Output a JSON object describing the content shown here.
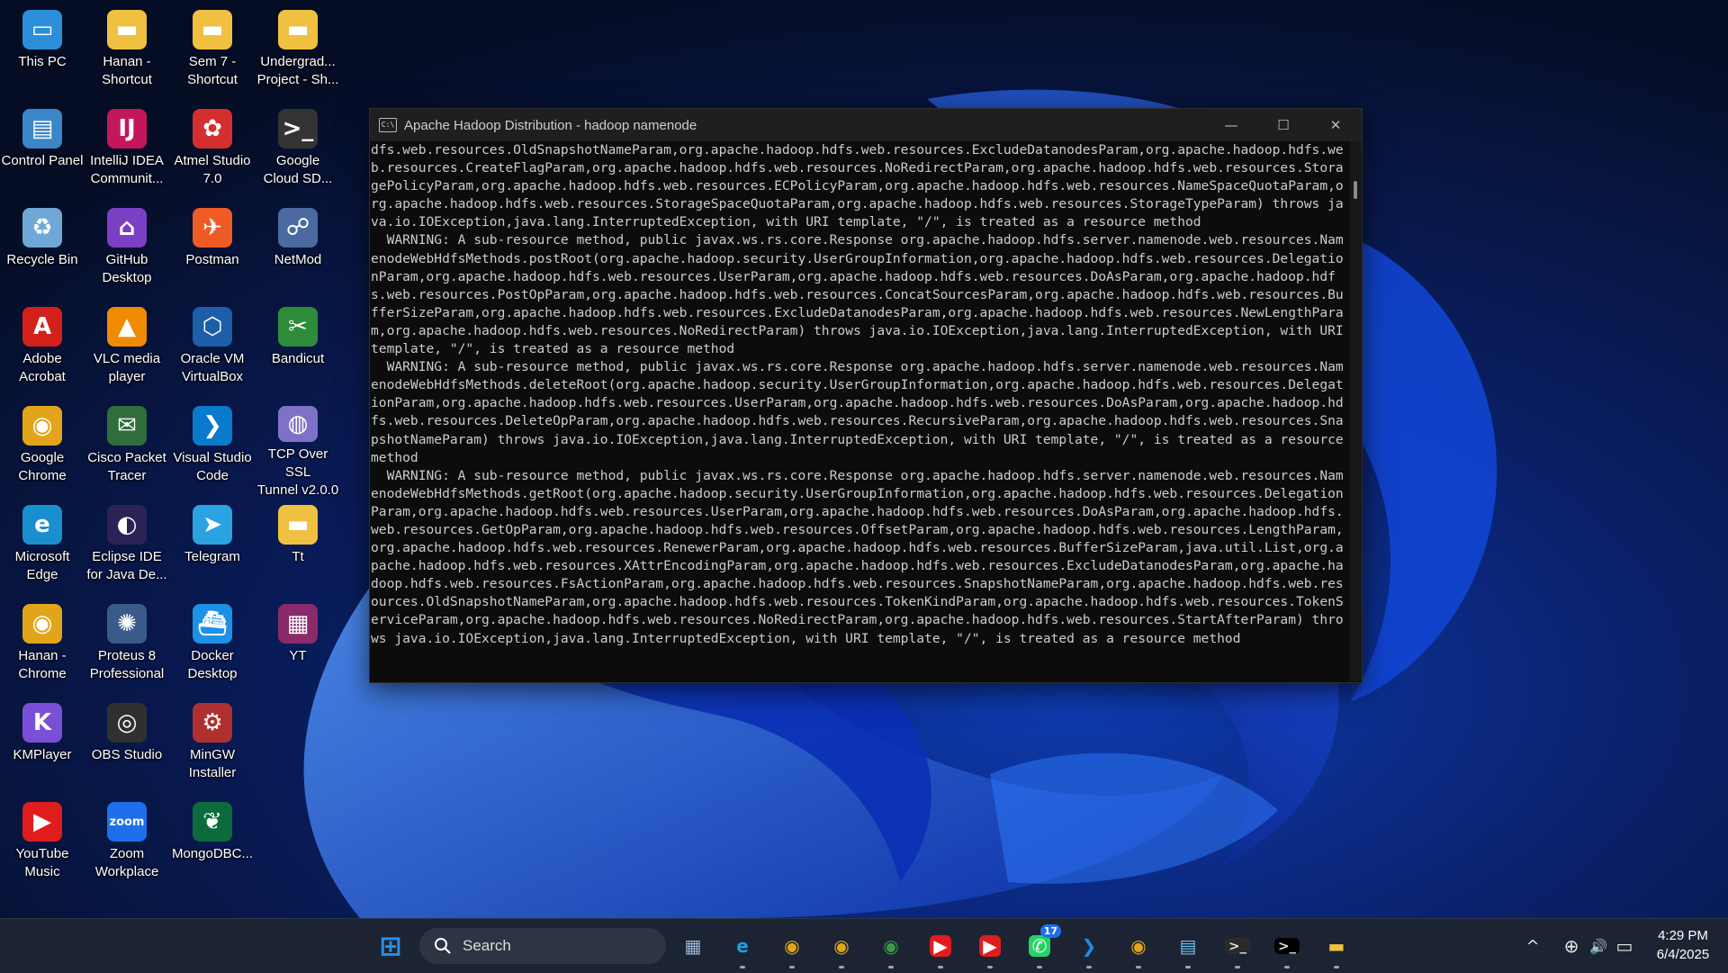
{
  "desktop_icons": [
    {
      "label": "This PC",
      "icon": "this-pc-icon",
      "color": "#2a8fd8",
      "glyph": "▭"
    },
    {
      "label": "Control Panel",
      "icon": "control-panel-icon",
      "color": "#3b86c8",
      "glyph": "▤"
    },
    {
      "label": "Recycle Bin",
      "icon": "recycle-bin-icon",
      "color": "#6fa8d6",
      "glyph": "♻"
    },
    {
      "label": "Adobe\nAcrobat",
      "icon": "adobe-acrobat-icon",
      "color": "#d4201a",
      "glyph": "A"
    },
    {
      "label": "Google\nChrome",
      "icon": "chrome-icon",
      "color": "#e2a51a",
      "glyph": "◉"
    },
    {
      "label": "Microsoft\nEdge",
      "icon": "edge-icon",
      "color": "#1a8fd0",
      "glyph": "e"
    },
    {
      "label": "Hanan -\nChrome",
      "icon": "chrome-profile-icon",
      "color": "#e2a51a",
      "glyph": "◉"
    },
    {
      "label": "KMPlayer",
      "icon": "kmplayer-icon",
      "color": "#7a4fd8",
      "glyph": "K"
    },
    {
      "label": "YouTube\nMusic",
      "icon": "youtube-music-icon",
      "color": "#e01c1c",
      "glyph": "▶"
    },
    {
      "label": "Hanan -\nShortcut",
      "icon": "folder-icon",
      "color": "#f0c040",
      "glyph": "▬"
    },
    {
      "label": "IntelliJ IDEA\nCommunit...",
      "icon": "intellij-icon",
      "color": "#c2185b",
      "glyph": "IJ"
    },
    {
      "label": "GitHub\nDesktop",
      "icon": "github-desktop-icon",
      "color": "#7b3fc4",
      "glyph": "⌂"
    },
    {
      "label": "VLC media\nplayer",
      "icon": "vlc-icon",
      "color": "#f08a00",
      "glyph": "▲"
    },
    {
      "label": "Cisco Packet\nTracer",
      "icon": "cisco-packet-tracer-icon",
      "color": "#2f6e3a",
      "glyph": "✉"
    },
    {
      "label": "Eclipse IDE\nfor Java De...",
      "icon": "eclipse-icon",
      "color": "#2c2255",
      "glyph": "◐"
    },
    {
      "label": "Proteus 8\nProfessional",
      "icon": "proteus-icon",
      "color": "#3a5a8a",
      "glyph": "✺"
    },
    {
      "label": "OBS Studio",
      "icon": "obs-studio-icon",
      "color": "#303030",
      "glyph": "◎"
    },
    {
      "label": "Zoom\nWorkplace",
      "icon": "zoom-icon",
      "color": "#1f6feb",
      "glyph": "zoom"
    },
    {
      "label": "Sem 7 -\nShortcut",
      "icon": "folder-icon",
      "color": "#f0c040",
      "glyph": "▬"
    },
    {
      "label": "Atmel Studio\n7.0",
      "icon": "atmel-studio-icon",
      "color": "#d32f2f",
      "glyph": "✿"
    },
    {
      "label": "Postman",
      "icon": "postman-icon",
      "color": "#ef5b25",
      "glyph": "✈"
    },
    {
      "label": "Oracle VM\nVirtualBox",
      "icon": "virtualbox-icon",
      "color": "#1c5ea8",
      "glyph": "⬡"
    },
    {
      "label": "Visual Studio\nCode",
      "icon": "vscode-icon",
      "color": "#0a7acc",
      "glyph": "❯"
    },
    {
      "label": "Telegram",
      "icon": "telegram-icon",
      "color": "#2aa3e0",
      "glyph": "➤"
    },
    {
      "label": "Docker\nDesktop",
      "icon": "docker-icon",
      "color": "#1d91e6",
      "glyph": "⛴"
    },
    {
      "label": "MinGW\nInstaller",
      "icon": "mingw-icon",
      "color": "#b03030",
      "glyph": "⚙"
    },
    {
      "label": "MongoDBC...",
      "icon": "mongodb-compass-icon",
      "color": "#0c6b3a",
      "glyph": "❦"
    },
    {
      "label": "Undergrad...\nProject - Sh...",
      "icon": "folder-icon",
      "color": "#f0c040",
      "glyph": "▬"
    },
    {
      "label": "Google\nCloud SD...",
      "icon": "google-cloud-sdk-icon",
      "color": "#333",
      "glyph": ">_"
    },
    {
      "label": "NetMod",
      "icon": "netmod-icon",
      "color": "#4a6aa0",
      "glyph": "☍"
    },
    {
      "label": "Bandicut",
      "icon": "bandicut-icon",
      "color": "#2e8b3a",
      "glyph": "✂"
    },
    {
      "label": "TCP Over SSL\nTunnel v2.0.0",
      "icon": "tcp-over-ssl-icon",
      "color": "#7e72c8",
      "glyph": "◍"
    },
    {
      "label": "Tt",
      "icon": "folder-icon",
      "color": "#f0c040",
      "glyph": "▬"
    },
    {
      "label": "YT",
      "icon": "winrar-icon",
      "color": "#8a2a6a",
      "glyph": "▦"
    }
  ],
  "console": {
    "title": "Apache Hadoop Distribution - hadoop   namenode",
    "minimize": "—",
    "maximize": "☐",
    "close": "✕",
    "text": "dfs.web.resources.OldSnapshotNameParam,org.apache.hadoop.hdfs.web.resources.ExcludeDatanodesParam,org.apache.hadoop.hdfs.web.resources.CreateFlagParam,org.apache.hadoop.hdfs.web.resources.NoRedirectParam,org.apache.hadoop.hdfs.web.resources.StoragePolicyParam,org.apache.hadoop.hdfs.web.resources.ECPolicyParam,org.apache.hadoop.hdfs.web.resources.NameSpaceQuotaParam,org.apache.hadoop.hdfs.web.resources.StorageSpaceQuotaParam,org.apache.hadoop.hdfs.web.resources.StorageTypeParam) throws java.io.IOException,java.lang.InterruptedException, with URI template, \"/\", is treated as a resource method\n  WARNING: A sub-resource method, public javax.ws.rs.core.Response org.apache.hadoop.hdfs.server.namenode.web.resources.NamenodeWebHdfsMethods.postRoot(org.apache.hadoop.security.UserGroupInformation,org.apache.hadoop.hdfs.web.resources.DelegationParam,org.apache.hadoop.hdfs.web.resources.UserParam,org.apache.hadoop.hdfs.web.resources.DoAsParam,org.apache.hadoop.hdfs.web.resources.PostOpParam,org.apache.hadoop.hdfs.web.resources.ConcatSourcesParam,org.apache.hadoop.hdfs.web.resources.BufferSizeParam,org.apache.hadoop.hdfs.web.resources.ExcludeDatanodesParam,org.apache.hadoop.hdfs.web.resources.NewLengthParam,org.apache.hadoop.hdfs.web.resources.NoRedirectParam) throws java.io.IOException,java.lang.InterruptedException, with URI template, \"/\", is treated as a resource method\n  WARNING: A sub-resource method, public javax.ws.rs.core.Response org.apache.hadoop.hdfs.server.namenode.web.resources.NamenodeWebHdfsMethods.deleteRoot(org.apache.hadoop.security.UserGroupInformation,org.apache.hadoop.hdfs.web.resources.DelegationParam,org.apache.hadoop.hdfs.web.resources.UserParam,org.apache.hadoop.hdfs.web.resources.DoAsParam,org.apache.hadoop.hdfs.web.resources.DeleteOpParam,org.apache.hadoop.hdfs.web.resources.RecursiveParam,org.apache.hadoop.hdfs.web.resources.SnapshotNameParam) throws java.io.IOException,java.lang.InterruptedException, with URI template, \"/\", is treated as a resource method\n  WARNING: A sub-resource method, public javax.ws.rs.core.Response org.apache.hadoop.hdfs.server.namenode.web.resources.NamenodeWebHdfsMethods.getRoot(org.apache.hadoop.security.UserGroupInformation,org.apache.hadoop.hdfs.web.resources.DelegationParam,org.apache.hadoop.hdfs.web.resources.UserParam,org.apache.hadoop.hdfs.web.resources.DoAsParam,org.apache.hadoop.hdfs.web.resources.GetOpParam,org.apache.hadoop.hdfs.web.resources.OffsetParam,org.apache.hadoop.hdfs.web.resources.LengthParam,org.apache.hadoop.hdfs.web.resources.RenewerParam,org.apache.hadoop.hdfs.web.resources.BufferSizeParam,java.util.List,org.apache.hadoop.hdfs.web.resources.XAttrEncodingParam,org.apache.hadoop.hdfs.web.resources.ExcludeDatanodesParam,org.apache.hadoop.hdfs.web.resources.FsActionParam,org.apache.hadoop.hdfs.web.resources.SnapshotNameParam,org.apache.hadoop.hdfs.web.resources.OldSnapshotNameParam,org.apache.hadoop.hdfs.web.resources.TokenKindParam,org.apache.hadoop.hdfs.web.resources.TokenServiceParam,org.apache.hadoop.hdfs.web.resources.NoRedirectParam,org.apache.hadoop.hdfs.web.resources.StartAfterParam) throws java.io.IOException,java.lang.InterruptedException, with URI template, \"/\", is treated as a resource method"
  },
  "taskbar": {
    "search_label": "Search",
    "apps": [
      {
        "name": "start-button",
        "icon": "windows-logo-icon",
        "glyph": "⊞",
        "color": "#2a8fe8",
        "bg": "transparent"
      },
      {
        "name": "taskbar-task-view",
        "icon": "task-view-icon",
        "glyph": "▦",
        "color": "#9fb7d6",
        "bg": "transparent"
      },
      {
        "name": "taskbar-edge",
        "icon": "edge-icon",
        "glyph": "e",
        "color": "#1aa0e0",
        "bg": "transparent"
      },
      {
        "name": "taskbar-chrome-1",
        "icon": "chrome-icon",
        "glyph": "◉",
        "color": "#e2a51a",
        "bg": "transparent"
      },
      {
        "name": "taskbar-chrome-2",
        "icon": "chrome-icon",
        "glyph": "◉",
        "color": "#e2a51a",
        "bg": "transparent"
      },
      {
        "name": "taskbar-chrome-3",
        "icon": "chrome-icon",
        "glyph": "◉",
        "color": "#3a9a4a",
        "bg": "transparent"
      },
      {
        "name": "taskbar-youtube",
        "icon": "youtube-icon",
        "glyph": "▶",
        "color": "#ffffff",
        "bg": "#e01c1c"
      },
      {
        "name": "taskbar-youtube-music",
        "icon": "youtube-music-icon",
        "glyph": "▶",
        "color": "#ffffff",
        "bg": "#e01c1c"
      },
      {
        "name": "taskbar-whatsapp",
        "icon": "whatsapp-icon",
        "glyph": "✆",
        "color": "#ffffff",
        "bg": "#25d366",
        "badge": "17"
      },
      {
        "name": "taskbar-vscode",
        "icon": "vscode-icon",
        "glyph": "❯",
        "color": "#1a8fe6",
        "bg": "transparent"
      },
      {
        "name": "taskbar-chrome-4",
        "icon": "chrome-icon",
        "glyph": "◉",
        "color": "#e2a51a",
        "bg": "transparent"
      },
      {
        "name": "taskbar-notepad",
        "icon": "notepad-icon",
        "glyph": "▤",
        "color": "#6fc0f0",
        "bg": "transparent"
      },
      {
        "name": "taskbar-terminal",
        "icon": "terminal-icon",
        "glyph": ">_",
        "color": "#dddddd",
        "bg": "#2a2a2a"
      },
      {
        "name": "taskbar-cmd",
        "icon": "command-prompt-icon",
        "glyph": ">_",
        "color": "#dddddd",
        "bg": "#000000"
      },
      {
        "name": "taskbar-file-explorer",
        "icon": "folder-icon",
        "glyph": "▬",
        "color": "#f0c040",
        "bg": "transparent"
      }
    ],
    "tray": {
      "chevron": "^",
      "language_icon": "⊕",
      "volume_icon": "🔊",
      "battery_icon": "▭"
    },
    "time": "4:29 PM",
    "date": "6/4/2025"
  }
}
